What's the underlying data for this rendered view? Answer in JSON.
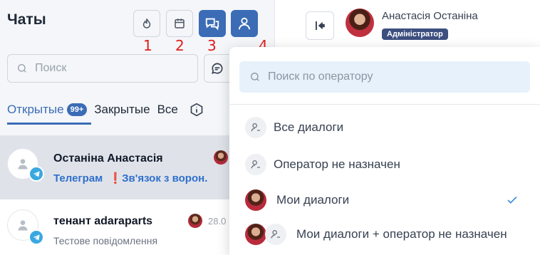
{
  "left": {
    "title": "Чаты",
    "annotations": [
      "1",
      "2",
      "3",
      "4"
    ],
    "search_placeholder": "Поиск",
    "tabs": [
      {
        "label": "Открытые",
        "badge": "99+"
      },
      {
        "label": "Закрытые"
      },
      {
        "label": "Все"
      }
    ],
    "chats": [
      {
        "name": "Останіна Анастасія",
        "channel": "Телеграм",
        "preview": "Зв'язок з ворон."
      },
      {
        "name": "тенант adaraparts",
        "date": "28.0",
        "preview": "Тестове повідомлення"
      }
    ]
  },
  "header": {
    "user_name": "Анастасія Останіна",
    "role": "Адміністратор"
  },
  "dropdown": {
    "search_placeholder": "Поиск по оператору",
    "items": [
      {
        "label": "Все диалоги",
        "icon": "operator-icon"
      },
      {
        "label": "Оператор не назначен",
        "icon": "operator-icon"
      },
      {
        "label": "Мои диалоги",
        "icon": "user-photo",
        "selected": true
      },
      {
        "label": "Мои диалоги + оператор не назначен",
        "icon": "user-photo"
      }
    ]
  },
  "colors": {
    "accent": "#3b6cb5",
    "annotation": "#e11d1d",
    "telegram": "#3aa8e0"
  }
}
